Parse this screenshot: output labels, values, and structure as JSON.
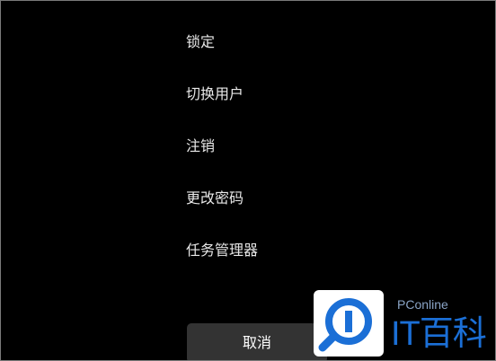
{
  "menu": {
    "items": [
      {
        "label": "锁定"
      },
      {
        "label": "切换用户"
      },
      {
        "label": "注销"
      },
      {
        "label": "更改密码"
      },
      {
        "label": "任务管理器"
      }
    ]
  },
  "cancel_button": {
    "label": "取消"
  },
  "watermark": {
    "brand": "PConline",
    "text": "IT百科",
    "icon": "magnifier-logo-icon",
    "colors": {
      "primary": "#1b6fd6",
      "secondary": "#8aa4c6"
    }
  },
  "colors": {
    "background": "#000000",
    "text": "#e8e8e8",
    "button_bg": "#333333"
  }
}
